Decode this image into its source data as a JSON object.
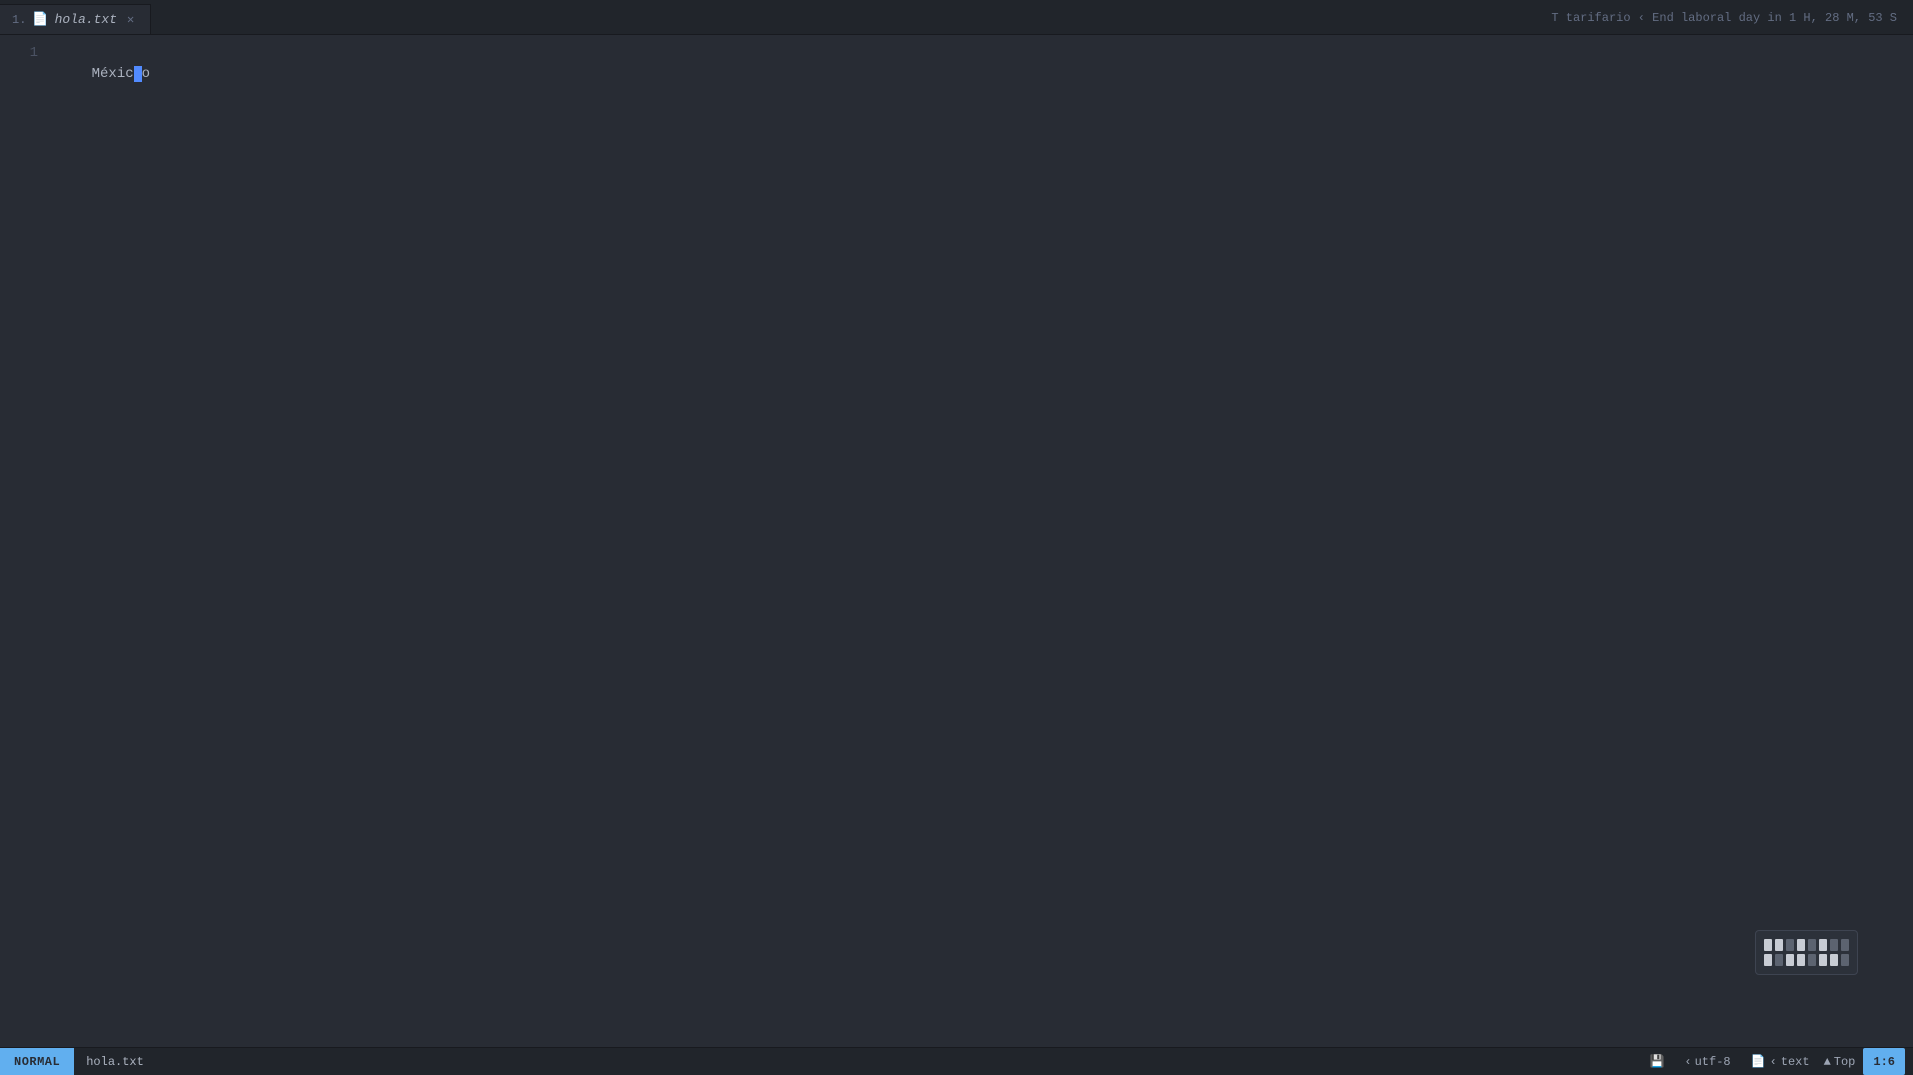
{
  "tab": {
    "number": "1.",
    "icon": "📄",
    "name": "hola.txt",
    "close": "✕"
  },
  "top_status": {
    "text": "T tarifario ‹ End laboral day in 1 H, 28 M, 53 S"
  },
  "editor": {
    "lines": [
      {
        "number": "1",
        "content_before": "Méxic",
        "content_after": "o"
      }
    ]
  },
  "status_bar": {
    "mode": "NORMAL",
    "filename": "hola.txt",
    "git_icon": "⎇",
    "encoding_arrow": "‹",
    "encoding": "utf-8",
    "file_icon": "📄",
    "type_arrow": "‹",
    "file_type": "text",
    "top_label": "Top",
    "position": "1:6"
  },
  "minimap": {
    "blocks": [
      {
        "lit": true
      },
      {
        "lit": true
      },
      {
        "lit": false
      },
      {
        "lit": true
      },
      {
        "lit": false
      },
      {
        "lit": true
      },
      {
        "lit": false
      },
      {
        "lit": false
      },
      {
        "lit": true
      },
      {
        "lit": false
      },
      {
        "lit": true
      },
      {
        "lit": true
      },
      {
        "lit": false
      },
      {
        "lit": true
      },
      {
        "lit": true
      },
      {
        "lit": false
      }
    ]
  }
}
